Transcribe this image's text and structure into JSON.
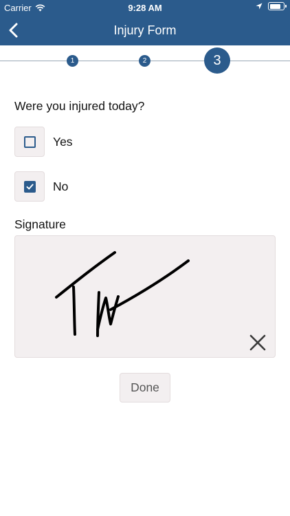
{
  "status_bar": {
    "carrier": "Carrier",
    "time": "9:28 AM",
    "wifi_icon": "wifi-icon",
    "location_icon": "location-arrow-icon",
    "battery_icon": "battery-icon"
  },
  "nav": {
    "title": "Injury Form",
    "back_icon": "chevron-left-icon"
  },
  "stepper": {
    "steps": [
      "1",
      "2",
      "3"
    ],
    "current_step": 3
  },
  "question": "Were you injured today?",
  "options": [
    {
      "label": "Yes",
      "checked": false
    },
    {
      "label": "No",
      "checked": true
    }
  ],
  "signature": {
    "label": "Signature",
    "clear_icon": "close-icon"
  },
  "done_label": "Done",
  "colors": {
    "primary": "#2b5b8c",
    "field_bg": "#f3eff0",
    "field_border": "#e3dcdd"
  }
}
